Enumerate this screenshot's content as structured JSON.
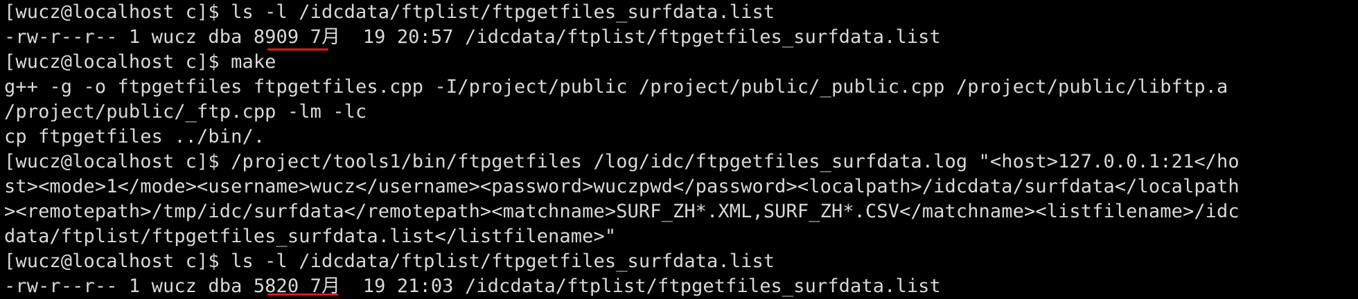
{
  "terminal": {
    "lines": [
      "[wucz@localhost c]$ ls -l /idcdata/ftplist/ftpgetfiles_surfdata.list",
      "-rw-r--r-- 1 wucz dba 8909 7月  19 20:57 /idcdata/ftplist/ftpgetfiles_surfdata.list",
      "[wucz@localhost c]$ make",
      "g++ -g -o ftpgetfiles ftpgetfiles.cpp -I/project/public /project/public/_public.cpp /project/public/libftp.a",
      "/project/public/_ftp.cpp -lm -lc",
      "cp ftpgetfiles ../bin/.",
      "[wucz@localhost c]$ /project/tools1/bin/ftpgetfiles /log/idc/ftpgetfiles_surfdata.log \"<host>127.0.0.1:21</ho",
      "st><mode>1</mode><username>wucz</username><password>wuczpwd</password><localpath>/idcdata/surfdata</localpath",
      "><remotepath>/tmp/idc/surfdata</remotepath><matchname>SURF_ZH*.XML,SURF_ZH*.CSV</matchname><listfilename>/idc",
      "data/ftplist/ftpgetfiles_surfdata.list</listfilename>\"",
      "[wucz@localhost c]$ ls -l /idcdata/ftplist/ftpgetfiles_surfdata.list",
      "-rw-r--r-- 1 wucz dba 5820 7月  19 21:03 /idcdata/ftplist/ftpgetfiles_surfdata.list"
    ],
    "colors": {
      "background": "#000000",
      "text": "#d9d9d9",
      "annotation": "#e8141b"
    }
  }
}
